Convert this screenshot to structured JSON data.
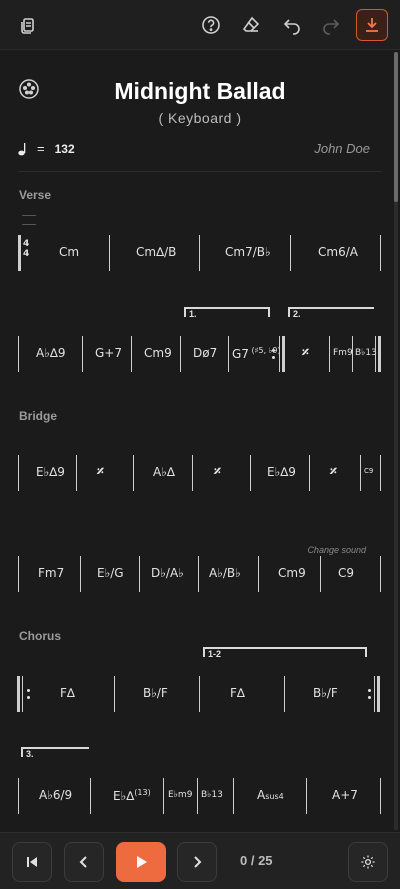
{
  "song": {
    "title": "Midnight Ballad",
    "instrument": "( Keyboard )",
    "tempo_value": "132",
    "composer": "John Doe"
  },
  "sections": {
    "verse": "Verse",
    "bridge": "Bridge",
    "chorus": "Chorus"
  },
  "rows": {
    "r1": {
      "time_sig_top": "4",
      "time_sig_bottom": "4",
      "chords": [
        "Cm",
        "Cm∆/B",
        "Cm7/B♭",
        "Cm6/A"
      ]
    },
    "r2": {
      "chords": [
        "A♭∆9",
        "G+7",
        "Cm9",
        "Dø7",
        "G7",
        "G7 (♯5, ♭9)",
        "Fm9",
        "B♭13"
      ],
      "ending1": "1.",
      "ending2": "2."
    },
    "r3": {
      "chords": [
        "E♭∆9",
        "A♭∆",
        "E♭∆9",
        "C9"
      ]
    },
    "r4": {
      "chords": [
        "Fm7",
        "E♭/G",
        "D♭/A♭",
        "A♭/B♭",
        "Cm9",
        "C9"
      ]
    },
    "r5": {
      "chords": [
        "F∆",
        "B♭/F",
        "F∆",
        "B♭/F"
      ],
      "ending": "1-2"
    },
    "r6": {
      "chords": [
        "A♭6/9",
        "E♭∆",
        "(13)",
        "E♭m9",
        "B♭13",
        "A",
        "sus4",
        "A+7"
      ],
      "ending": "3."
    }
  },
  "change_sound": "Change sound",
  "playback": {
    "counter": "0 / 25"
  },
  "icons": {
    "copy": "copy-icon",
    "help": "help-icon",
    "eraser": "eraser-icon",
    "undo": "undo-icon",
    "redo": "redo-icon",
    "export": "download-icon",
    "palette": "palette-icon",
    "skip_start": "skip-to-start-icon",
    "prev": "chevron-left-icon",
    "play": "play-icon",
    "next": "chevron-right-icon",
    "settings": "gear-icon"
  },
  "colors": {
    "accent": "#ee6b3f",
    "background": "#1b1b1b"
  }
}
